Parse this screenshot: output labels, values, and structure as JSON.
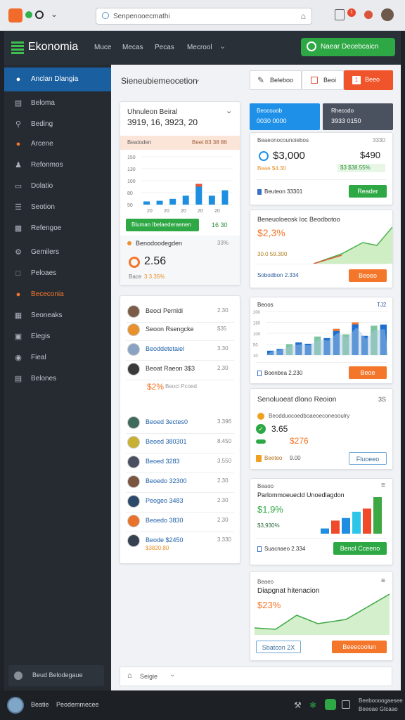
{
  "browser": {
    "url": "Senpenooecmathi",
    "badge_count": "1"
  },
  "app": {
    "logo_text": "Ekonomia",
    "nav": [
      "Muce",
      "Mecas",
      "Pecas",
      "Mecrool"
    ],
    "cta_label": "Naear Decebcaicn"
  },
  "sidebar": {
    "items": [
      {
        "label": "Anclan Dlangia",
        "icon": "globe-icon",
        "active": true
      },
      {
        "label": "Beloma",
        "icon": "document-icon"
      },
      {
        "label": "Beding",
        "icon": "search-icon"
      },
      {
        "label": "Arcene",
        "icon": "circle-icon"
      },
      {
        "label": "Refonmos",
        "icon": "user-icon"
      },
      {
        "label": "Dolatio",
        "icon": "monitor-icon"
      },
      {
        "label": "Seotion",
        "icon": "list-icon"
      },
      {
        "label": "Refengoe",
        "icon": "book-icon"
      },
      {
        "label": "Gemilers",
        "icon": "settings-icon"
      },
      {
        "label": "Peloaes",
        "icon": "square-icon"
      },
      {
        "label": "Bececonia",
        "icon": "circle-icon",
        "highlight": true
      },
      {
        "label": "Seoneaks",
        "icon": "grid-icon"
      },
      {
        "label": "Elegis",
        "icon": "box-icon"
      },
      {
        "label": "Fieal",
        "icon": "dot-icon"
      },
      {
        "label": "Belones",
        "icon": "layers-icon"
      }
    ],
    "bottom_label": "Beud Belodegaue"
  },
  "main": {
    "header_title": "Sieneubiemeocetion",
    "btn_edit": "Beleboo",
    "btn_doc": "Beoi",
    "btn_orange": "Beeo"
  },
  "card1": {
    "title": "Uhnuleon Beiral",
    "value": "3919, 16, 3923, 20",
    "sub_left": "Beatoden",
    "sub_right": "Beet 83 38 86",
    "yticks": [
      "150",
      "130",
      "100",
      "80",
      "50"
    ],
    "xticks": [
      "20",
      "20",
      "20",
      "20",
      "20"
    ],
    "green_label": "Bluman Ibelaederaenen",
    "green_value": "16 30",
    "info_label": "Benodoodegden",
    "info_value": "33%",
    "metric": "2.56",
    "metric_sub": "Bace",
    "metric_change": "3 3.35%"
  },
  "list": [
    {
      "name": "Beoci Pernldi",
      "value": "2.30",
      "color": "#7a5c48"
    },
    {
      "name": "Seoon Rsengcke",
      "value": "$35",
      "color": "#e8912c"
    },
    {
      "name": "Beoddetetaiel",
      "value": "3.30",
      "color": "#8aa3c2",
      "link": true
    },
    {
      "name": "Beoat Raeon 3$3",
      "value": "2.30",
      "color": "#3a3a3a"
    },
    {
      "name": "$2%",
      "value": "Beoci Pcoed",
      "color": "#ffffff",
      "orange": true
    },
    {
      "name": "Beoed 3ectes0",
      "value": "3.396",
      "color": "#3e6b5b",
      "link": true
    },
    {
      "name": "Beoed 380301",
      "value": "8.450",
      "color": "#c8b030",
      "link": true
    },
    {
      "name": "Beoed 3283",
      "value": "3.550",
      "color": "#4a5060",
      "link": true
    },
    {
      "name": "Beoedo 32300",
      "value": "2.30",
      "color": "#7a5540",
      "link": true
    },
    {
      "name": "Peogeo 3483",
      "value": "2.30",
      "color": "#2e4a6a",
      "link": true
    },
    {
      "name": "Beoedo 3830",
      "value": "2.30",
      "color": "#e8712c",
      "link": true
    },
    {
      "name": "Beode $2450",
      "value": "3.330",
      "color": "#354050",
      "link": true,
      "extra": "$3820.80"
    }
  ],
  "right_cards": {
    "blue_card": {
      "title": "Beocouob",
      "value": "0030 0000"
    },
    "dark_card": {
      "title": "Rhecodo",
      "value": "3933 0150"
    },
    "summary": {
      "label": "Beaeonocounoiebos",
      "label_right": "3330",
      "value1": "$3,000",
      "value2": "$490",
      "change_left": "Beae $4.30",
      "change_right": "$3 $38.55%",
      "footer_label": "Beuteon 33301",
      "btn": "Reader"
    },
    "trend": {
      "title": "Beneuoloeosk Ioc Beodbotoo",
      "value": "$2,3%",
      "sub": "30.0 59.300",
      "footer": "Sobodbon 2.334",
      "btn": "Beoeo"
    },
    "bar": {
      "title": "Beoos",
      "right": "TJ2",
      "footer": "Boenbea 2.230",
      "btn": "Beoe",
      "yticks": [
        "200",
        "150",
        "100",
        "50",
        "10"
      ]
    },
    "status": {
      "title": "Senoluoeat dlono Reoion",
      "close": "3S",
      "line1": "Beodduocoedboaeoeconeooulry",
      "line2": "3.65",
      "line3": "$276",
      "footer_left": "Beeteo",
      "footer_val": "9.00",
      "btn": "Fluoeeo"
    },
    "bar2": {
      "title": "Beaoo",
      "subtitle": "Parlommoeuecld Unoedlagdon",
      "value": "$1,9%",
      "sub": "$3,930%",
      "footer": "Suacnaeo 2.334",
      "btn": "Benol Cceeno"
    },
    "area": {
      "title": "Beaeo",
      "subtitle": "Diapgnat hitenacion",
      "value": "$23%",
      "btn_left": "Sbatcon 2X",
      "btn_right": "Beeecoolun"
    }
  },
  "main_footer": "Seigie",
  "footer": {
    "user1": "Beatie",
    "user2": "Peodemmecee",
    "right_top": "Beeboooogaesee",
    "right_bottom": "Beeoae Gtcaao"
  },
  "chart_data": [
    {
      "type": "bar",
      "categories": [
        "20",
        "20",
        "20",
        "20",
        "20",
        "20",
        "20"
      ],
      "values": [
        10,
        12,
        18,
        28,
        65,
        28,
        45
      ],
      "ylim": [
        0,
        150
      ]
    },
    {
      "type": "bar",
      "categories": [
        "1",
        "2",
        "3",
        "4",
        "5",
        "6",
        "7",
        "8",
        "9",
        "10",
        "11",
        "12",
        "13"
      ],
      "values": [
        20,
        28,
        50,
        58,
        52,
        85,
        78,
        120,
        95,
        150,
        88,
        135,
        140
      ],
      "ylim": [
        0,
        200
      ]
    },
    {
      "type": "bar",
      "categories": [
        "1",
        "2",
        "3",
        "4",
        "5",
        "6"
      ],
      "values": [
        10,
        25,
        30,
        42,
        48,
        70
      ]
    }
  ],
  "colors": {
    "accent_green": "#2ea844",
    "accent_orange": "#f4762a",
    "accent_blue": "#1e90e8",
    "sidebar_active": "#1a5fa0"
  }
}
